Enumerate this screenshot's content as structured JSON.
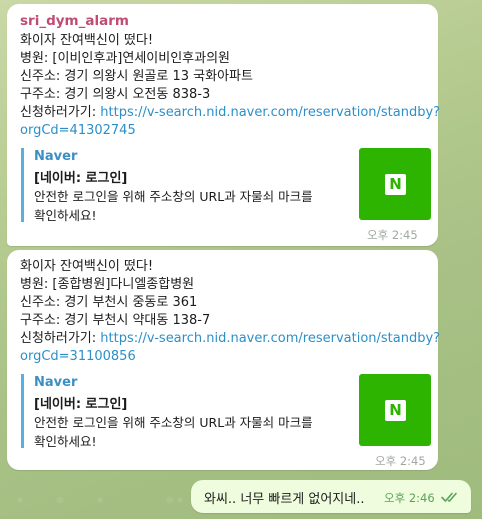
{
  "messages": [
    {
      "sender": "sri_dym_alarm",
      "lines": [
        "화이자 잔여백신이 떴다!",
        "병원: [이비인후과]연세이비인후과의원",
        "신주소: 경기 의왕시 원골로 13 국화아파트",
        "구주소: 경기 의왕시 오전동 838-3"
      ],
      "link_prefix": "신청하러가기: ",
      "link_line1": "https://v-search.nid.naver.com/reservation/standby?",
      "link_line2": "orgCd=41302745",
      "preview": {
        "site": "Naver",
        "heading": "[네이버: 로그인]",
        "desc1": "안전한 로그인을 위해 주소창의 URL과 자물쇠 마크를",
        "desc2": "확인하세요!"
      },
      "time": "오후 2:45"
    },
    {
      "lines": [
        "화이자 잔여백신이 떴다!",
        "병원: [종합병원]다니엘종합병원",
        "신주소: 경기 부천시 중동로 361",
        "구주소: 경기 부천시 약대동 138-7"
      ],
      "link_prefix": "신청하러가기: ",
      "link_line1": "https://v-search.nid.naver.com/reservation/standby?",
      "link_line2": "orgCd=31100856",
      "preview": {
        "site": "Naver",
        "heading": "[네이버: 로그인]",
        "desc1": "안전한 로그인을 위해 주소창의 URL과 자물쇠 마크를",
        "desc2": "확인하세요!"
      },
      "time": "오후 2:45"
    }
  ],
  "outgoing": {
    "text": "와씨.. 너무 빠르게 없어지네..",
    "time": "오후 2:46",
    "status_icon": "double-check-icon"
  },
  "logo_letter": "N",
  "colors": {
    "sender": "#c04b73",
    "link": "#2c8fc8",
    "preview_accent": "#5aaee0",
    "naver_green": "#2db400",
    "outgoing_bubble": "#effdde"
  }
}
